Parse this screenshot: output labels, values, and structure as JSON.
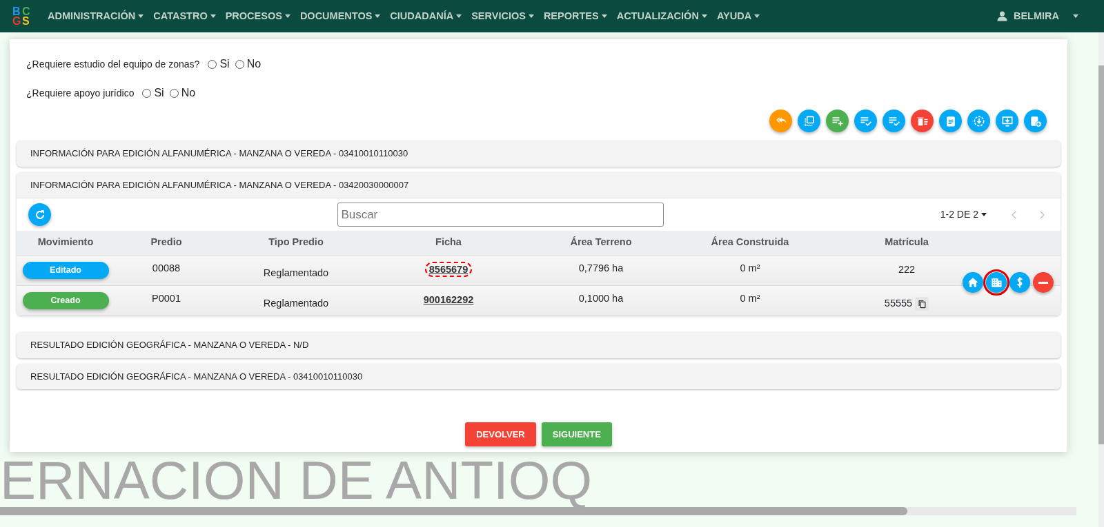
{
  "navbar": {
    "logo": [
      "B",
      "C",
      "G",
      "S"
    ],
    "menu": [
      {
        "label": "ADMINISTRACIÓN"
      },
      {
        "label": "CATASTRO"
      },
      {
        "label": "PROCESOS"
      },
      {
        "label": "DOCUMENTOS"
      },
      {
        "label": "CIUDADANÍA"
      },
      {
        "label": "SERVICIOS"
      },
      {
        "label": "REPORTES"
      },
      {
        "label": "ACTUALIZACIÓN"
      },
      {
        "label": "AYUDA"
      }
    ],
    "user": "BELMIRA"
  },
  "questions": [
    {
      "label": "¿Requiere estudio del equipo de zonas?",
      "options": [
        {
          "label": "Si",
          "checked": false
        },
        {
          "label": "No",
          "checked": false
        }
      ]
    },
    {
      "label": "¿Requiere apoyo jurídico",
      "options": [
        {
          "label": "Si",
          "checked": false
        },
        {
          "label": "No",
          "checked": false
        }
      ]
    }
  ],
  "toolbar": [
    {
      "color": "#ff9800"
    },
    {
      "color": "#03a9f4"
    },
    {
      "color": "#4caf50"
    },
    {
      "color": "#03a9f4"
    },
    {
      "color": "#03a9f4"
    },
    {
      "color": "#f44336"
    },
    {
      "color": "#03a9f4"
    },
    {
      "color": "#03a9f4"
    },
    {
      "color": "#03a9f4"
    },
    {
      "color": "#03a9f4"
    }
  ],
  "panels": [
    {
      "title": "INFORMACIÓN PARA EDICIÓN ALFANUMÉRICA - MANZANA O VEREDA - 03410010110030",
      "expanded": false
    },
    {
      "title": "INFORMACIÓN PARA EDICIÓN ALFANUMÉRICA - MANZANA O VEREDA - 03420030000007",
      "expanded": true,
      "table": {
        "search": {
          "placeholder": "Buscar"
        },
        "pagination": "1-2 DE 2",
        "columns": [
          "Movimiento",
          "Predio",
          "Tipo Predio",
          "Ficha",
          "Área Terreno",
          "Área Construida",
          "Matrícula"
        ],
        "rows": [
          {
            "movimiento": "Editado",
            "color": "#03a9f4",
            "predio": "00088",
            "tipo": "Reglamentado",
            "ficha": "8565679",
            "ficha_highlighted": true,
            "area_terreno": "0,7796 ha",
            "area_construida": "0 m²",
            "matricula": "222",
            "copy": false
          },
          {
            "movimiento": "Creado",
            "color": "#4caf50",
            "predio": "P0001",
            "tipo": "Reglamentado",
            "ficha": "900162292",
            "ficha_highlighted": false,
            "area_terreno": "0,1000 ha",
            "area_construida": "0 m²",
            "matricula": "55555",
            "copy": true
          }
        ],
        "actions": [
          {
            "color": "#03a9f4",
            "highlighted": false
          },
          {
            "color": "#03a9f4",
            "highlighted": true
          },
          {
            "color": "#03a9f4",
            "highlighted": false
          },
          {
            "color": "#f44336",
            "highlighted": false
          }
        ]
      }
    },
    {
      "title": "RESULTADO EDICIÓN GEOGRÁFICA - MANZANA O VEREDA - N/D",
      "expanded": false
    },
    {
      "title": "RESULTADO EDICIÓN GEOGRÁFICA - MANZANA O VEREDA - 03410010110030",
      "expanded": false
    }
  ],
  "buttons": [
    {
      "label": "DEVOLVER",
      "color": "#f44336"
    },
    {
      "label": "SIGUIENTE",
      "color": "#4caf50"
    }
  ],
  "background_text": "ERNACION DE ANTIOQ"
}
